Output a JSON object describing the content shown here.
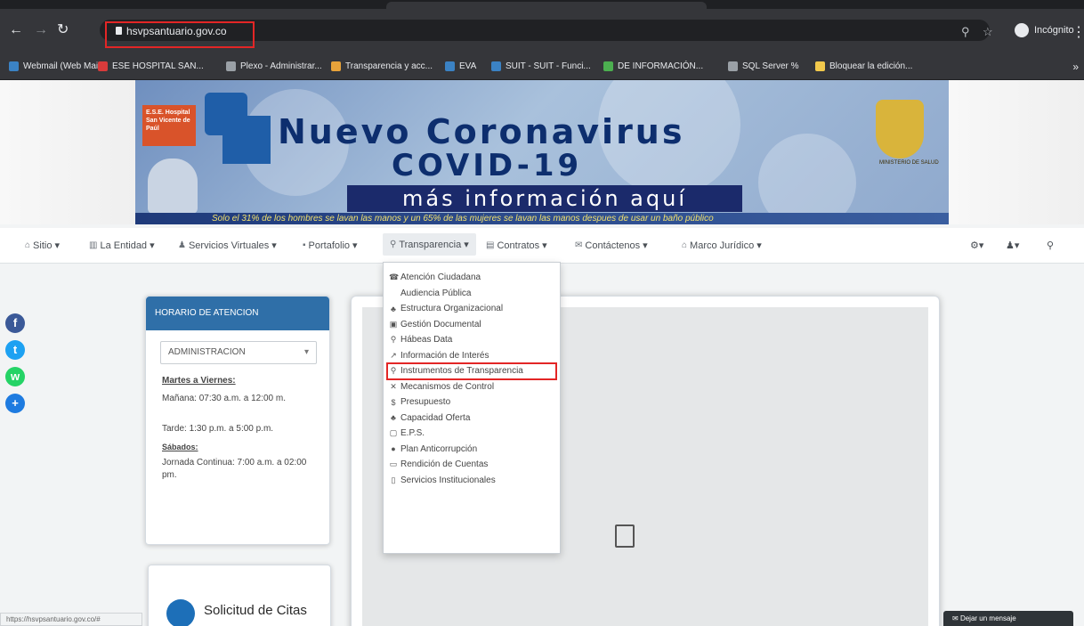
{
  "browser": {
    "url": "hsvpsantuario.gov.co",
    "incognito_label": "Incógnito",
    "bookmarks": [
      {
        "label": "Webmail (Web Mail...",
        "color": "#3b82c4"
      },
      {
        "label": "ESE HOSPITAL SAN...",
        "color": "#d83b3b"
      },
      {
        "label": "Plexo - Administrar...",
        "color": "#9aa0a6"
      },
      {
        "label": "Transparencia y acc...",
        "color": "#e8a33a"
      },
      {
        "label": "EVA",
        "color": "#3b82c4"
      },
      {
        "label": "SUIT - SUIT - Funci...",
        "color": "#3b82c4"
      },
      {
        "label": "DE INFORMACIÓN...",
        "color": "#4caf50"
      },
      {
        "label": "SQL Server %",
        "color": "#9aa0a6"
      },
      {
        "label": "Bloquear la edición...",
        "color": "#f2c94c"
      }
    ]
  },
  "banner": {
    "logo_text": "E.S.E. Hospital San Vicente de Paúl",
    "title_line1": "Nuevo Coronavirus",
    "title_line2": "COVID-19",
    "title_line3": "más información aquí",
    "footer": "Solo el 31% de los hombres se lavan las manos y un 65% de las mujeres se lavan las manos despues de usar un baño público",
    "shield_label": "MINISTERIO DE SALUD"
  },
  "menu": {
    "items": [
      "Sitio",
      "La Entidad",
      "Servicios Virtuales",
      "Portafolio",
      "Transparencia",
      "Contratos",
      "Contáctenos",
      "Marco Jurídico"
    ],
    "right_icons": [
      "gear-icon",
      "user-icon",
      "search-icon"
    ]
  },
  "dropdown": {
    "items": [
      {
        "label": "Atención Ciudadana",
        "icon": "☎"
      },
      {
        "label": "Audiencia Pública",
        "icon": ""
      },
      {
        "label": "Estructura Organizacional",
        "icon": "♣"
      },
      {
        "label": "Gestión Documental",
        "icon": "▣"
      },
      {
        "label": "Hábeas Data",
        "icon": "⚲"
      },
      {
        "label": "Información de Interés",
        "icon": "↗"
      },
      {
        "label": "Instrumentos de Transparencia",
        "icon": "⚲"
      },
      {
        "label": "Mecanismos de Control",
        "icon": "✕"
      },
      {
        "label": "Presupuesto",
        "icon": "$"
      },
      {
        "label": "Capacidad Oferta",
        "icon": "♣"
      },
      {
        "label": "E.P.S.",
        "icon": "▢"
      },
      {
        "label": "Plan Anticorrupción",
        "icon": "●"
      },
      {
        "label": "Rendición de Cuentas",
        "icon": "▭"
      },
      {
        "label": "Servicios Institucionales",
        "icon": "▯"
      }
    ],
    "highlighted_index": 6
  },
  "schedule": {
    "header": "HORARIO DE ATENCION",
    "selected": "ADMINISTRACION",
    "weekday_title": "Martes a Viernes:",
    "morning": "Mañana: 07:30 a.m. a 12:00 m.",
    "afternoon": "Tarde: 1:30 p.m. a 5:00 p.m.",
    "saturday_title": "Sábados:",
    "saturday": "Jornada Continua: 7:00 a.m. a 02:00 pm."
  },
  "citas": {
    "label": "Solicitud de Citas"
  },
  "status": {
    "link": "https://hsvpsantuario.gov.co/#"
  },
  "chat": {
    "label": "Dejar un mensaje"
  },
  "social": [
    {
      "icon": "facebook-icon",
      "glyph": "f",
      "color": "#3b5998"
    },
    {
      "icon": "twitter-icon",
      "glyph": "t",
      "color": "#1da1f2"
    },
    {
      "icon": "whatsapp-icon",
      "glyph": "w",
      "color": "#25d366"
    },
    {
      "icon": "share-plus-icon",
      "glyph": "+",
      "color": "#1e7be0"
    }
  ]
}
